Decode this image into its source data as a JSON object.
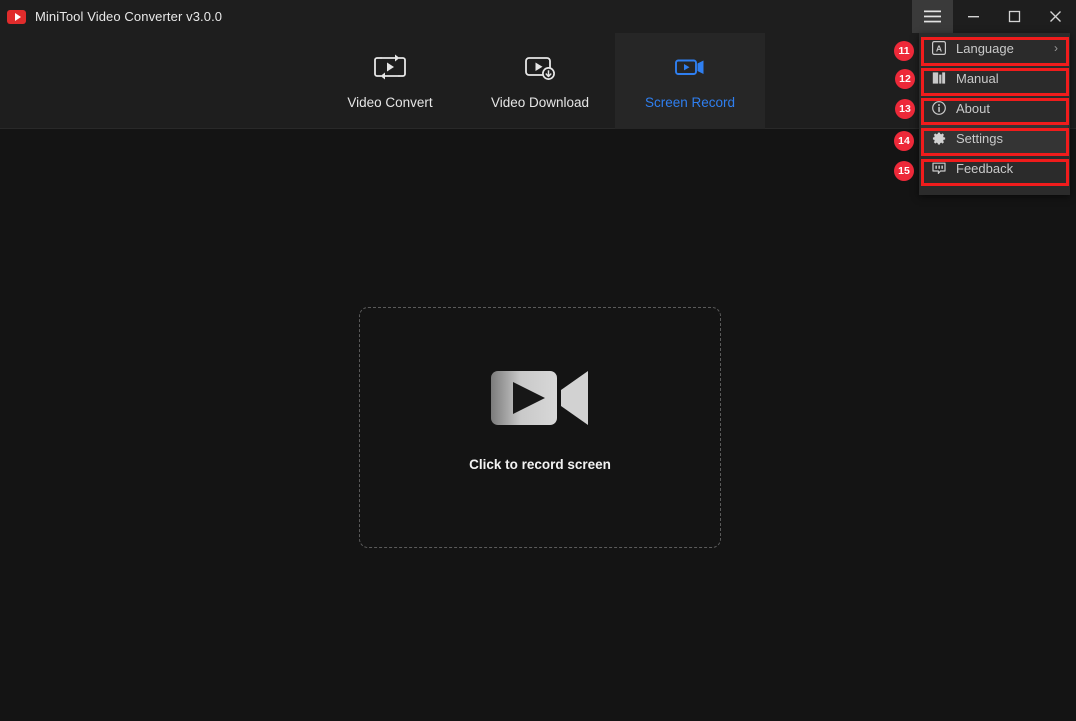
{
  "window": {
    "title": "MiniTool Video Converter v3.0.0",
    "logo_icon": "minitool-play-logo",
    "controls": [
      {
        "name": "menu",
        "icon": "hamburger-icon",
        "active": true
      },
      {
        "name": "minimize",
        "icon": "minimize-icon",
        "active": false
      },
      {
        "name": "maximize",
        "icon": "maximize-icon",
        "active": false
      },
      {
        "name": "close",
        "icon": "close-icon",
        "active": false
      }
    ]
  },
  "tabs": [
    {
      "id": "convert",
      "label": "Video Convert",
      "icon": "video-convert-icon",
      "active": false
    },
    {
      "id": "download",
      "label": "Video Download",
      "icon": "video-download-icon",
      "active": false
    },
    {
      "id": "record",
      "label": "Screen Record",
      "icon": "screen-record-icon",
      "active": true
    }
  ],
  "dropzone": {
    "label": "Click to record screen",
    "icon": "camcorder-icon"
  },
  "menu": {
    "items": [
      {
        "label": "Language",
        "icon": "language-icon",
        "chevron": "›",
        "highlighted": false,
        "badge": "11"
      },
      {
        "label": "Manual",
        "icon": "manual-book-icon",
        "chevron": "",
        "highlighted": false,
        "badge": "12"
      },
      {
        "label": "About",
        "icon": "info-circle-icon",
        "chevron": "",
        "highlighted": false,
        "badge": "13"
      },
      {
        "label": "Settings",
        "icon": "gear-icon",
        "chevron": "",
        "highlighted": true,
        "badge": "14"
      },
      {
        "label": "Feedback",
        "icon": "feedback-chat-icon",
        "chevron": "",
        "highlighted": false,
        "badge": "15"
      }
    ]
  },
  "colors": {
    "accent_blue": "#2f7ff0",
    "annotation_red": "#f01c1c",
    "badge_red": "#ed2939",
    "logo_red": "#e02c2c",
    "titlebar_bg": "#1e1e1e",
    "body_bg": "#141414",
    "menu_bg": "#2b2b2b"
  }
}
